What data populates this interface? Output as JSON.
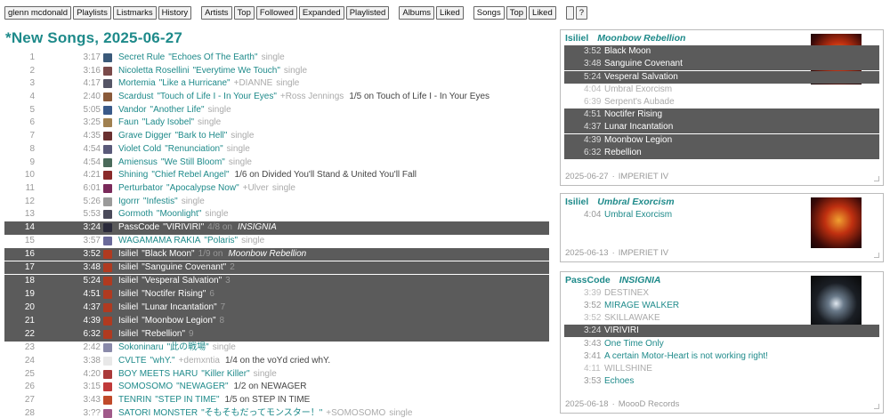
{
  "nav": {
    "user": "glenn mcdonald",
    "playlists": "Playlists",
    "listmarks": "Listmarks",
    "history": "History",
    "artists": "Artists",
    "artists_top": "Top",
    "followed": "Followed",
    "expanded": "Expanded",
    "playlisted": "Playlisted",
    "albums": "Albums",
    "albums_liked": "Liked",
    "songs": "Songs",
    "songs_top": "Top",
    "songs_liked": "Liked",
    "blank": "",
    "help": "?"
  },
  "title": "*New Songs, 2025-06-27",
  "songs": [
    {
      "n": "1",
      "d": "3:17",
      "artist": "Secret Rule",
      "title": "\"Echoes Of The Earth\"",
      "kind": "single",
      "feat": "",
      "extra": "",
      "hl": false,
      "color": "#3b5a7a"
    },
    {
      "n": "2",
      "d": "3:16",
      "artist": "Nicoletta Rosellini",
      "title": "\"Everytime We Touch\"",
      "kind": "single",
      "feat": "",
      "extra": "",
      "hl": false,
      "color": "#7a4a4a"
    },
    {
      "n": "3",
      "d": "4:17",
      "artist": "Mortemia",
      "title": "\"Like a Hurricane\"",
      "kind": "",
      "feat": "+DIANNE",
      "extra": "single",
      "hl": false,
      "color": "#555566"
    },
    {
      "n": "4",
      "d": "2:40",
      "artist": "Scardust",
      "title": "\"Touch of Life I - In Your Eyes\"",
      "kind": "",
      "feat": "+Ross Jennings",
      "extra": "1/5 on Touch of Life I - In Your Eyes",
      "hl": false,
      "color": "#8a5a3a"
    },
    {
      "n": "5",
      "d": "5:05",
      "artist": "Vandor",
      "title": "\"Another Life\"",
      "kind": "single",
      "feat": "",
      "extra": "",
      "hl": false,
      "color": "#3a5a8a"
    },
    {
      "n": "6",
      "d": "3:25",
      "artist": "Faun",
      "title": "\"Lady Isobel\"",
      "kind": "single",
      "feat": "",
      "extra": "",
      "hl": false,
      "color": "#a08050"
    },
    {
      "n": "7",
      "d": "4:35",
      "artist": "Grave Digger",
      "title": "\"Bark to Hell\"",
      "kind": "single",
      "feat": "",
      "extra": "",
      "hl": false,
      "color": "#6a3030"
    },
    {
      "n": "8",
      "d": "4:54",
      "artist": "Violet Cold",
      "title": "\"Renunciation\"",
      "kind": "single",
      "feat": "",
      "extra": "",
      "hl": false,
      "color": "#5a5a7a"
    },
    {
      "n": "9",
      "d": "4:54",
      "artist": "Amiensus",
      "title": "\"We Still Bloom\"",
      "kind": "single",
      "feat": "",
      "extra": "",
      "hl": false,
      "color": "#4a6a5a"
    },
    {
      "n": "10",
      "d": "4:21",
      "artist": "Shining",
      "title": "\"Chief Rebel Angel\"",
      "kind": "",
      "feat": "",
      "extra": "1/6 on Divided You'll Stand & United You'll Fall",
      "hl": false,
      "color": "#8a2a2a"
    },
    {
      "n": "11",
      "d": "6:01",
      "artist": "Perturbator",
      "title": "\"Apocalypse Now\"",
      "kind": "",
      "feat": "+Ulver",
      "extra": "single",
      "hl": false,
      "color": "#7a2a5a"
    },
    {
      "n": "12",
      "d": "5:26",
      "artist": "Igorrr",
      "title": "\"Infestis\"",
      "kind": "single",
      "feat": "",
      "extra": "",
      "hl": false,
      "color": "#9a9a9a"
    },
    {
      "n": "13",
      "d": "5:53",
      "artist": "Gormoth",
      "title": "\"Moonlight\"",
      "kind": "single",
      "feat": "",
      "extra": "",
      "hl": false,
      "color": "#4a4a5a"
    },
    {
      "n": "14",
      "d": "3:24",
      "artist": "PassCode",
      "title": "\"VIRIVIRI\"",
      "kind": "4/8 on",
      "feat": "",
      "extra": "INSIGNIA",
      "hl": true,
      "color": "#2a2a3a"
    },
    {
      "n": "15",
      "d": "3:57",
      "artist": "WAGAMAMA RAKIA",
      "title": "\"Polaris\"",
      "kind": "single",
      "feat": "",
      "extra": "",
      "hl": false,
      "color": "#6a6a9a"
    },
    {
      "n": "16",
      "d": "3:52",
      "artist": "Isiliel",
      "title": "\"Black Moon\"",
      "kind": "1/9 on",
      "feat": "",
      "extra": "Moonbow Rebellion",
      "hl": true,
      "color": "#b03a20"
    },
    {
      "n": "17",
      "d": "3:48",
      "artist": "Isiliel",
      "title": "\"Sanguine Covenant\"",
      "kind": "2",
      "feat": "",
      "extra": "",
      "hl": true,
      "color": "#b03a20"
    },
    {
      "n": "18",
      "d": "5:24",
      "artist": "Isiliel",
      "title": "\"Vesperal Salvation\"",
      "kind": "3",
      "feat": "",
      "extra": "",
      "hl": true,
      "color": "#b03a20"
    },
    {
      "n": "19",
      "d": "4:51",
      "artist": "Isiliel",
      "title": "\"Noctifer Rising\"",
      "kind": "6",
      "feat": "",
      "extra": "",
      "hl": true,
      "color": "#b03a20"
    },
    {
      "n": "20",
      "d": "4:37",
      "artist": "Isiliel",
      "title": "\"Lunar Incantation\"",
      "kind": "7",
      "feat": "",
      "extra": "",
      "hl": true,
      "color": "#b03a20"
    },
    {
      "n": "21",
      "d": "4:39",
      "artist": "Isiliel",
      "title": "\"Moonbow Legion\"",
      "kind": "8",
      "feat": "",
      "extra": "",
      "hl": true,
      "color": "#b03a20"
    },
    {
      "n": "22",
      "d": "6:32",
      "artist": "Isiliel",
      "title": "\"Rebellion\"",
      "kind": "9",
      "feat": "",
      "extra": "",
      "hl": true,
      "color": "#b03a20"
    },
    {
      "n": "23",
      "d": "2:42",
      "artist": "Sokoninaru",
      "title": "\"此の戦場\"",
      "kind": "single",
      "feat": "",
      "extra": "",
      "hl": false,
      "color": "#8a8aaa"
    },
    {
      "n": "24",
      "d": "3:38",
      "artist": "CVLTE",
      "title": "\"whY.\"",
      "kind": "",
      "feat": "+demxntia",
      "extra": "1/4 on the voYd cried whY.",
      "hl": false,
      "color": "#e8e8e8"
    },
    {
      "n": "25",
      "d": "4:20",
      "artist": "BOY MEETS HARU",
      "title": "\"Killer Killer\"",
      "kind": "single",
      "feat": "",
      "extra": "",
      "hl": false,
      "color": "#aa3a3a"
    },
    {
      "n": "26",
      "d": "3:15",
      "artist": "SOMOSOMO",
      "title": "\"NEWAGER\"",
      "kind": "",
      "feat": "",
      "extra": "1/2 on NEWAGER",
      "hl": false,
      "color": "#c03a3a"
    },
    {
      "n": "27",
      "d": "3:43",
      "artist": "TENRIN",
      "title": "\"STEP IN TIME\"",
      "kind": "",
      "feat": "",
      "extra": "1/5 on STEP IN TIME",
      "hl": false,
      "color": "#c04a2a"
    },
    {
      "n": "28",
      "d": "3:??",
      "artist": "SATORI MONSTER",
      "title": "\"そもそもだってモンスター！\"",
      "kind": "",
      "feat": "+SOMOSOMO",
      "extra": "single",
      "hl": false,
      "color": "#a05a8a"
    }
  ],
  "cards": [
    {
      "artist": "Isiliel",
      "album": "Moonbow Rebellion",
      "date": "2025-06-27",
      "label": "IMPERIET IV",
      "tracks": [
        {
          "d": "3:52",
          "t": "Black Moon",
          "s": "hl"
        },
        {
          "d": "3:48",
          "t": "Sanguine Covenant",
          "s": "hl"
        },
        {
          "d": "5:24",
          "t": "Vesperal Salvation",
          "s": "hl"
        },
        {
          "d": "4:04",
          "t": "Umbral Exorcism",
          "s": "dim"
        },
        {
          "d": "6:39",
          "t": "Serpent's Aubade",
          "s": "dim"
        },
        {
          "d": "4:51",
          "t": "Noctifer Rising",
          "s": "hl"
        },
        {
          "d": "4:37",
          "t": "Lunar Incantation",
          "s": "hl"
        },
        {
          "d": "4:39",
          "t": "Moonbow Legion",
          "s": "hl"
        },
        {
          "d": "6:32",
          "t": "Rebellion",
          "s": "hl"
        }
      ]
    },
    {
      "artist": "Isiliel",
      "album": "Umbral Exorcism",
      "date": "2025-06-13",
      "label": "IMPERIET IV",
      "tracks": [
        {
          "d": "4:04",
          "t": "Umbral Exorcism",
          "s": "norm"
        }
      ]
    },
    {
      "artist": "PassCode",
      "album": "INSIGNIA",
      "date": "2025-06-18",
      "label": "MoooD Records",
      "tracks": [
        {
          "d": "3:39",
          "t": "DESTINEX",
          "s": "dim"
        },
        {
          "d": "3:52",
          "t": "MIRAGE WALKER",
          "s": "norm"
        },
        {
          "d": "3:52",
          "t": "SKILLAWAKE",
          "s": "dim"
        },
        {
          "d": "3:24",
          "t": "VIRIVIRI",
          "s": "hl"
        },
        {
          "d": "3:43",
          "t": "One Time Only",
          "s": "norm"
        },
        {
          "d": "3:41",
          "t": "A certain Motor-Heart is not working right!",
          "s": "norm"
        },
        {
          "d": "4:11",
          "t": "WILLSHINE",
          "s": "dim"
        },
        {
          "d": "3:53",
          "t": "Echoes",
          "s": "norm"
        }
      ]
    }
  ],
  "colors": {
    "accent": "#1e8a8a",
    "highlight": "#5b5b5b",
    "muted": "#999999"
  }
}
